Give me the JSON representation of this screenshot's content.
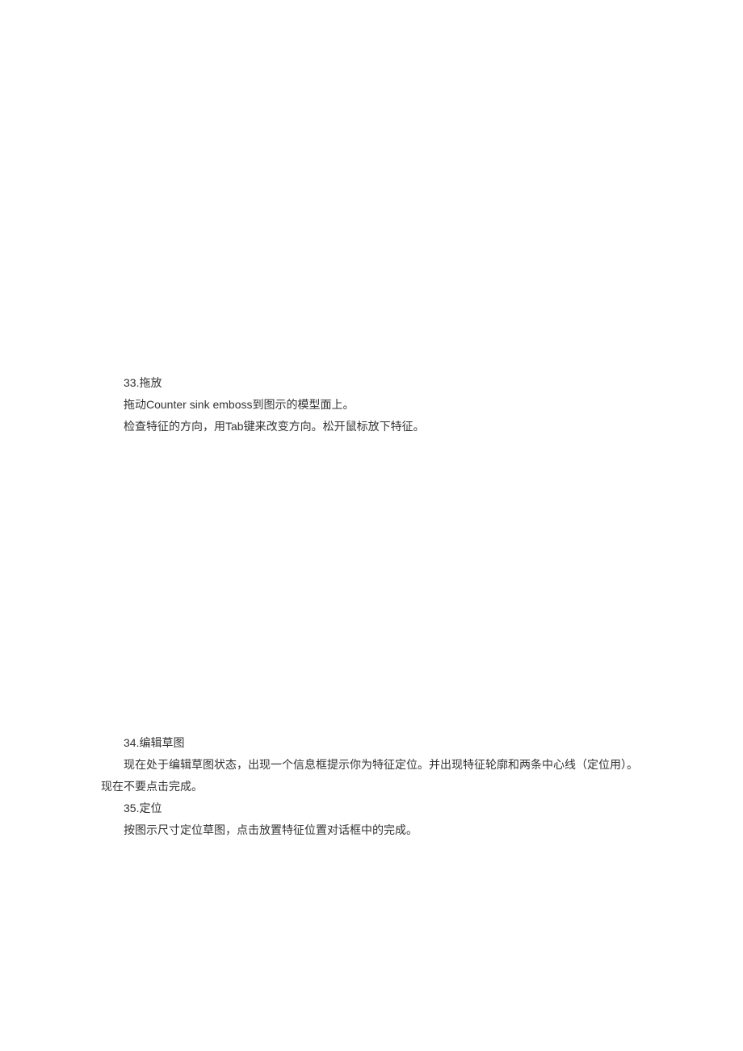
{
  "sections": {
    "s33": {
      "title": "33.拖放",
      "line1": "拖动Counter sink emboss到图示的模型面上。",
      "line2": "检查特征的方向，用Tab键来改变方向。松开鼠标放下特征。"
    },
    "s34": {
      "title": "34.编辑草图",
      "line1": "现在处于编辑草图状态，出现一个信息框提示你为特征定位。并出现特征轮廓和两条中心线（定位用）。",
      "line2": "现在不要点击完成。"
    },
    "s35": {
      "title": "35.定位",
      "line1": "按图示尺寸定位草图，点击放置特征位置对话框中的完成。"
    }
  }
}
